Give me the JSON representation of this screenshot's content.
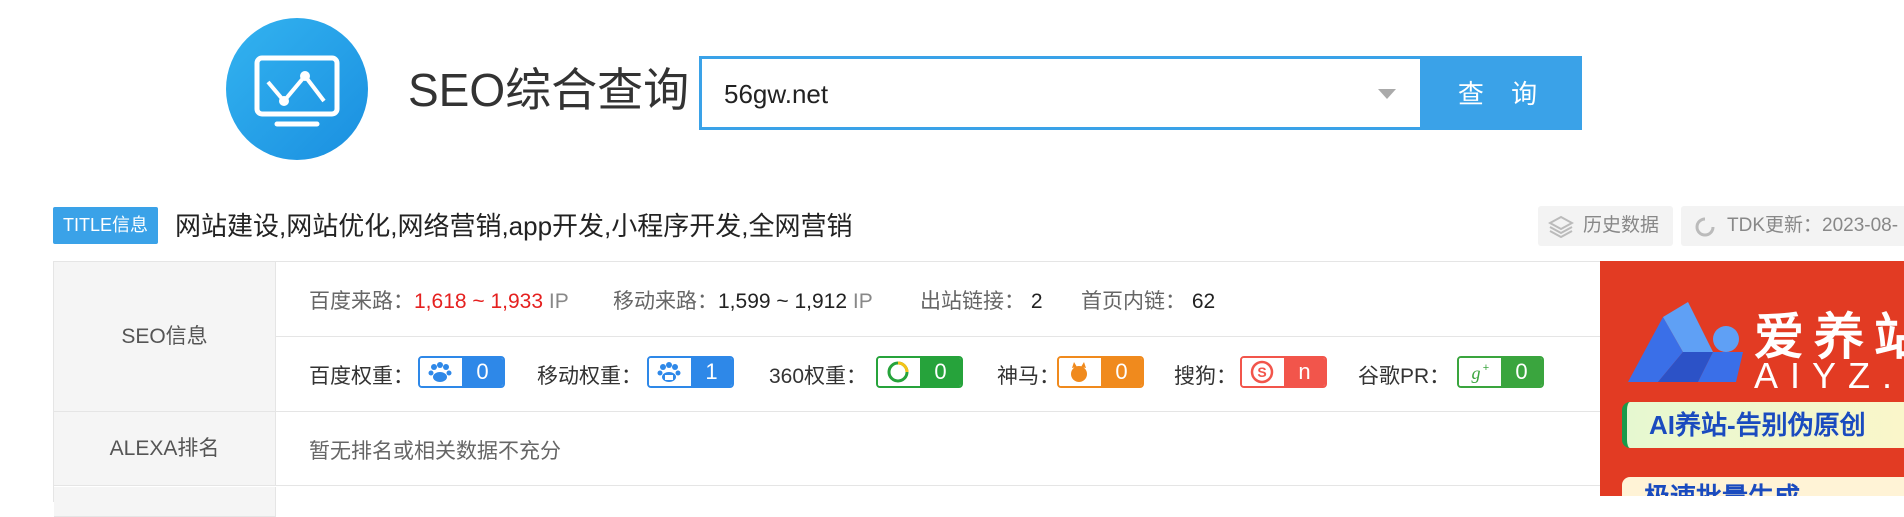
{
  "header": {
    "site_title": "SEO综合查询",
    "search_value": "56gw.net",
    "search_button": "查 询"
  },
  "title_row": {
    "badge": "TITLE信息",
    "text": "网站建设,网站优化,网络营销,app开发,小程序开发,全网营销",
    "history_label": "历史数据",
    "tdk_label": "TDK更新：2023-08-"
  },
  "seo": {
    "label": "SEO信息",
    "baidu_traffic_label": "百度来路：",
    "baidu_traffic_value": "1,618 ~ 1,933",
    "mobile_traffic_label": "移动来路：",
    "mobile_traffic_value": "1,599 ~ 1,912",
    "ip_unit": "IP",
    "outbound_label": "出站链接：",
    "outbound_value": "2",
    "inner_links_label": "首页内链：",
    "inner_links_value": "62",
    "weights": [
      {
        "label": "百度权重：",
        "value": "0",
        "icon": "baidu-paw-icon",
        "color": "#2e88e8"
      },
      {
        "label": "移动权重：",
        "value": "1",
        "icon": "baidu-mobile-paw-icon",
        "color": "#2e88e8"
      },
      {
        "label": "360权重：",
        "value": "0",
        "icon": "360-icon",
        "color": "#26a33b"
      },
      {
        "label": "神马：",
        "value": "0",
        "icon": "shenma-icon",
        "color": "#f08a1d"
      },
      {
        "label": "搜狗：",
        "value": "n",
        "icon": "sogou-icon",
        "color": "#f2554b"
      },
      {
        "label": "谷歌PR：",
        "value": "0",
        "icon": "google-plus-icon",
        "color": "#3aa53e"
      }
    ]
  },
  "alexa": {
    "label": "ALEXA排名",
    "value": "暂无排名或相关数据不充分"
  },
  "ad": {
    "brand_cn": "爱养站",
    "brand_en": "AIYZ.AI",
    "slogan": "AI养站-告别伪原创",
    "slogan2": "极速批量生成"
  }
}
